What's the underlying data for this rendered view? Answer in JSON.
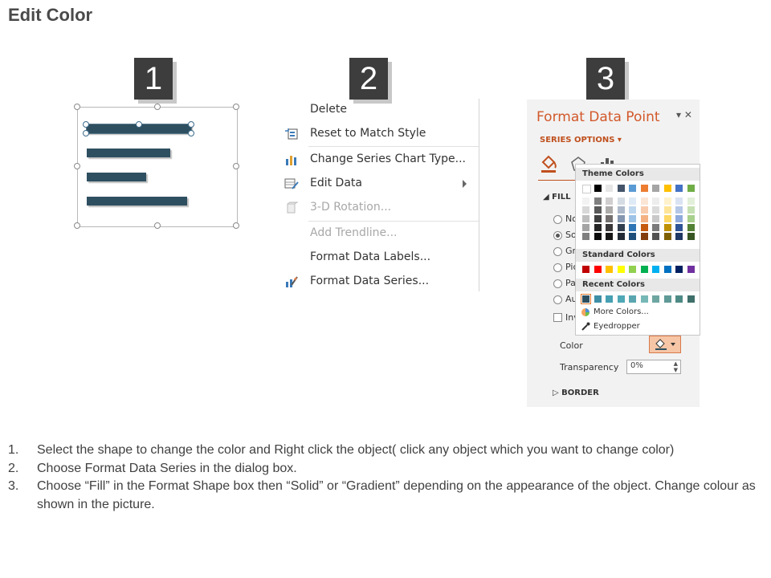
{
  "page": {
    "title": "Edit Color"
  },
  "steps": [
    "1",
    "2",
    "3"
  ],
  "context_menu": {
    "items": [
      {
        "label": "Delete",
        "enabled": true,
        "icon": "none"
      },
      {
        "label": "Reset to Match Style",
        "enabled": true,
        "icon": "reset-style-icon"
      },
      {
        "label": "Change Series Chart Type...",
        "enabled": true,
        "icon": "chart-type-icon"
      },
      {
        "label": "Edit Data",
        "enabled": true,
        "icon": "edit-data-icon",
        "submenu": true
      },
      {
        "label": "3-D Rotation...",
        "enabled": false,
        "icon": "rotation-icon"
      },
      {
        "label": "Add Trendline...",
        "enabled": false,
        "icon": "none"
      },
      {
        "label": "Format Data Labels...",
        "enabled": true,
        "icon": "none"
      },
      {
        "label": "Format Data Series...",
        "enabled": true,
        "icon": "format-series-icon"
      }
    ]
  },
  "format_pane": {
    "title": "Format Data Point",
    "series_options": "SERIES OPTIONS",
    "fill_header": "FILL",
    "fill_options": [
      "No",
      "So",
      "Gr",
      "Pic",
      "Pat",
      "Au"
    ],
    "selected_fill": "So",
    "invert_label": "Inv",
    "color_label": "Color",
    "transparency_label": "Transparency",
    "transparency_value": "0%",
    "border_header": "BORDER",
    "accent": "#d2582a"
  },
  "palette": {
    "theme_label": "Theme Colors",
    "standard_label": "Standard Colors",
    "recent_label": "Recent Colors",
    "more_colors": "More Colors...",
    "eyedropper": "Eyedropper",
    "theme_top": [
      "#ffffff",
      "#000000",
      "#e7e6e6",
      "#44546a",
      "#5b9bd5",
      "#ed7d31",
      "#a5a5a5",
      "#ffc000",
      "#4472c4",
      "#70ad47"
    ],
    "theme_shades": [
      [
        "#f2f2f2",
        "#7f7f7f",
        "#d0cece",
        "#d6dce4",
        "#deebf6",
        "#fbe5d5",
        "#ededed",
        "#fff2cc",
        "#dae3f3",
        "#e2efd9"
      ],
      [
        "#d8d8d8",
        "#595959",
        "#aeabab",
        "#adb9ca",
        "#bdd7ee",
        "#f8cbad",
        "#dbdbdb",
        "#fee599",
        "#b4c7e7",
        "#c5e0b3"
      ],
      [
        "#bfbfbf",
        "#3f3f3f",
        "#757070",
        "#8496b0",
        "#9dc3e6",
        "#f4b183",
        "#c9c9c9",
        "#ffd965",
        "#8faadc",
        "#a8d08d"
      ],
      [
        "#a5a5a5",
        "#262626",
        "#3a3838",
        "#323f4f",
        "#2e75b5",
        "#c55a11",
        "#7b7b7b",
        "#bf9000",
        "#2f5496",
        "#538135"
      ],
      [
        "#7f7f7f",
        "#0c0c0c",
        "#171616",
        "#222a35",
        "#1e4e79",
        "#833c0b",
        "#525252",
        "#7f6000",
        "#1f3864",
        "#375623"
      ]
    ],
    "standard": [
      "#c00000",
      "#ff0000",
      "#ffc000",
      "#ffff00",
      "#92d050",
      "#00b050",
      "#00b0f0",
      "#0070c0",
      "#002060",
      "#7030a0"
    ],
    "recent": [
      "#2e4f60",
      "#3e8fa6",
      "#46a0b2",
      "#4fa8b6",
      "#5aa6b0",
      "#76b8b6",
      "#6ea6a2",
      "#5f9a97",
      "#4e8a85",
      "#3f6f6a"
    ]
  },
  "panel1": {
    "bar_color": "#2e4f60",
    "bar_values": [
      1.0,
      0.8,
      0.57,
      1.0
    ]
  },
  "instructions": [
    {
      "num": "1.",
      "text": "Select the shape to change the color and Right click the object( click any object which you want to change color)"
    },
    {
      "num": "2.",
      "text": "Choose Format Data Series in the dialog box."
    },
    {
      "num": "3.",
      "text": "Choose “Fill” in the Format Shape box then “Solid” or “Gradient” depending on the appearance of the object. Change colour as shown in the picture."
    }
  ]
}
